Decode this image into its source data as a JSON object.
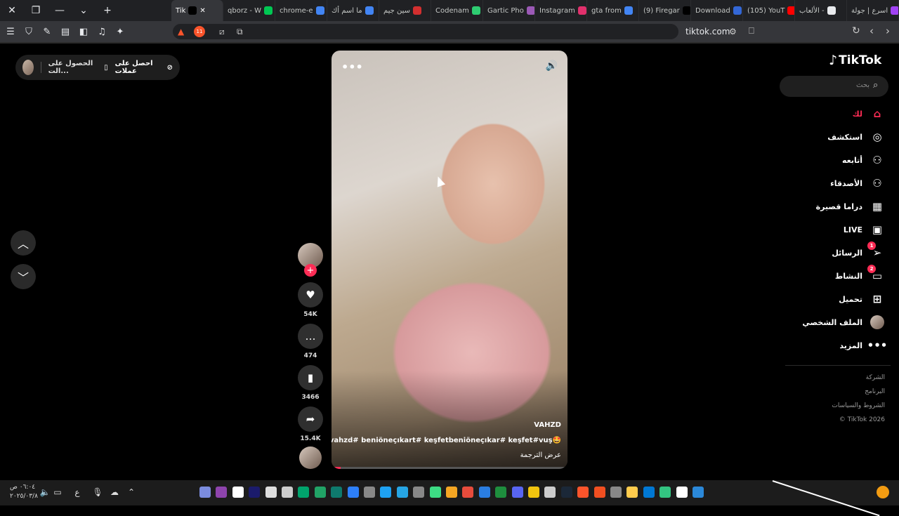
{
  "browser": {
    "tabs": [
      {
        "label": "اسرع | جولة",
        "color": "#a142f4"
      },
      {
        "label": "الألعاب -",
        "color": "#e8eaed"
      },
      {
        "label": "(105) YouT",
        "color": "#ff0000"
      },
      {
        "label": "Download",
        "color": "#3367d6"
      },
      {
        "label": "(9) Firegar",
        "color": "#000000"
      },
      {
        "label": "gta from",
        "color": "#4285f4"
      },
      {
        "label": "Instagram",
        "color": "#e1306c"
      },
      {
        "label": "Gartic Pho",
        "color": "#9b59b6"
      },
      {
        "label": "Codenam",
        "color": "#2ecc71"
      },
      {
        "label": "سين جيم",
        "color": "#d32f2f"
      },
      {
        "label": "ما اسم أك",
        "color": "#4285f4"
      },
      {
        "label": "chrome-e",
        "color": "#4285f4"
      },
      {
        "label": "qborz - W",
        "color": "#00c853"
      },
      {
        "label": "Tik",
        "color": "#000000",
        "active": true
      }
    ],
    "close_label": "✕",
    "url": "tiktok.com",
    "brave_count": "11"
  },
  "left_bar": {
    "get_coins": "احصل على عملات",
    "get_app": "الحصول على الت..."
  },
  "video": {
    "author": "VAHZD",
    "caption": "vahzd# beniöneçıkart# keşfetbeniöneçıkar# keşfet#vuş🤩",
    "translate": "عرض الترجمة",
    "progress": 0.04
  },
  "actions": {
    "likes": "54K",
    "comments": "474",
    "saves": "3466",
    "shares": "15.4K"
  },
  "sidebar": {
    "logo": "TikTok",
    "search_placeholder": "بحث",
    "items": [
      {
        "label": "لك",
        "icon": "home-icon",
        "active": true
      },
      {
        "label": "استكشف",
        "icon": "compass-icon"
      },
      {
        "label": "أتابعه",
        "icon": "user-follow-icon"
      },
      {
        "label": "الأصدقاء",
        "icon": "friends-icon"
      },
      {
        "label": "دراما قصيرة",
        "icon": "film-icon"
      },
      {
        "label": "LIVE",
        "icon": "live-icon"
      },
      {
        "label": "الرسائل",
        "icon": "send-icon",
        "badge": "1"
      },
      {
        "label": "النشاط",
        "icon": "activity-icon",
        "badge": "2"
      },
      {
        "label": "تحميل",
        "icon": "upload-icon"
      },
      {
        "label": "الملف الشخصي",
        "icon": "avatar"
      },
      {
        "label": "المزيد",
        "icon": "more-icon"
      }
    ],
    "footer": [
      "الشركة",
      "البرنامج",
      "الشروط والسياسات",
      "© TikTok 2026"
    ]
  },
  "taskbar": {
    "time": "٠٦:٠٤ ص",
    "date": "٢٠٢٥/٠٣/٨",
    "lang": "ع"
  }
}
